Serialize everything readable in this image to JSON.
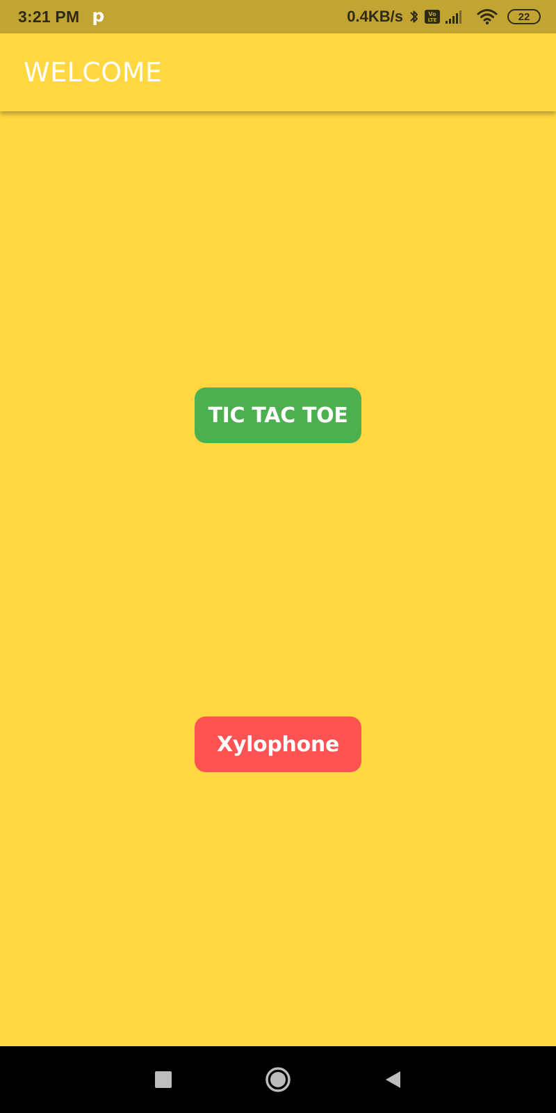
{
  "status_bar": {
    "time": "3:21 PM",
    "notification": "p",
    "network_speed": "0.4KB/s",
    "battery": "22",
    "icons": [
      "bluetooth-icon",
      "volte-icon",
      "signal-icon",
      "wifi-icon",
      "battery-icon"
    ]
  },
  "app_bar": {
    "title": "WELCOME"
  },
  "buttons": {
    "tic_tac_toe": "TIC TAC TOE",
    "xylophone": "Xylophone"
  },
  "nav_bar": {
    "icons": [
      "recents-square-icon",
      "home-circle-icon",
      "back-triangle-icon"
    ]
  },
  "colors": {
    "background": "#FFD740",
    "status_bar": "#C2A432",
    "tic_tac_toe_button": "#4CAF50",
    "xylophone_button": "#FF5252",
    "nav_bar": "#000000"
  }
}
